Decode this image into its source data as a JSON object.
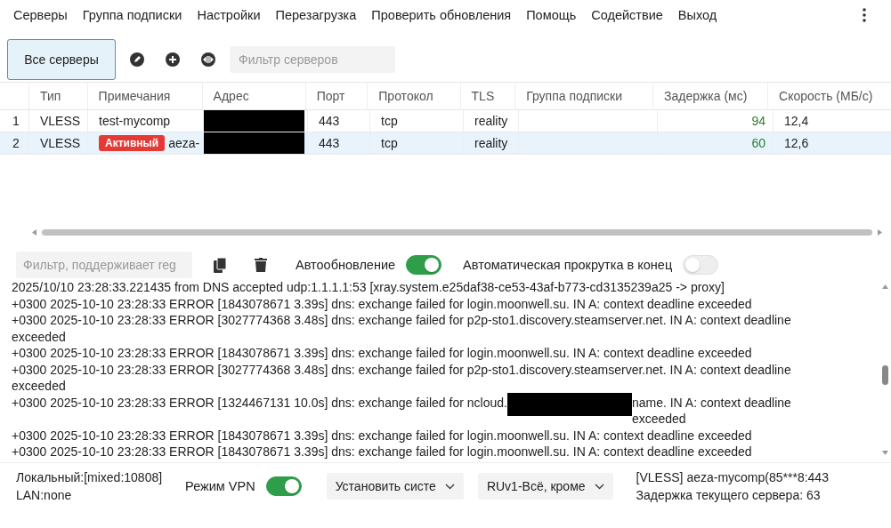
{
  "menu": [
    "Серверы",
    "Группа подписки",
    "Настройки",
    "Перезагрузка",
    "Проверить обновления",
    "Помощь",
    "Содействие",
    "Выход"
  ],
  "toolbar": {
    "tabs": [
      {
        "label": "Все серверы",
        "selected": true
      }
    ],
    "filter": {
      "placeholder": "Фильтр серверов"
    }
  },
  "table": {
    "columns": [
      "Тип",
      "Примечания",
      "Адрес",
      "Порт",
      "Протокол",
      "TLS",
      "Группа подписки",
      "Задержка (мс)",
      "Скорость (МБ/с)"
    ],
    "rows": [
      {
        "index": "1",
        "type": "VLESS",
        "badge": "",
        "note": "test-mycomp",
        "port": "443",
        "protocol": "tcp",
        "tls": "reality",
        "group": "",
        "delay": "94",
        "speed": "12,4",
        "selected": false
      },
      {
        "index": "2",
        "type": "VLESS",
        "badge": "Активный",
        "note": "aeza-",
        "port": "443",
        "protocol": "tcp",
        "tls": "reality",
        "group": "",
        "delay": "60",
        "speed": "12,6",
        "selected": true
      }
    ]
  },
  "log_toolbar": {
    "filter": {
      "placeholder": "Фильтр, поддерживает reg"
    },
    "auto_update": {
      "label": "Автообновление",
      "on": true
    },
    "auto_scroll": {
      "label": "Автоматическая прокрутка в конец",
      "on": false
    }
  },
  "log": [
    {
      "text": "2025/10/10 23:28:33.221435 from DNS accepted udp:1.1.1.1:53 [xray.system.e25daf38-ce53-43af-b773-cd3135239a25 -> proxy]"
    },
    {
      "text": "+0300 2025-10-10 23:28:33 ERROR [1843078671 3.39s] dns: exchange failed for login.moonwell.su. IN A: context deadline exceeded"
    },
    {
      "text": "+0300 2025-10-10 23:28:33 ERROR [3027774368 3.48s] dns: exchange failed for p2p-sto1.discovery.steamserver.net. IN A: context deadline exceeded"
    },
    {
      "text": "+0300 2025-10-10 23:28:33 ERROR [1843078671 3.39s] dns: exchange failed for login.moonwell.su. IN A: context deadline exceeded"
    },
    {
      "text": "+0300 2025-10-10 23:28:33 ERROR [3027774368 3.48s] dns: exchange failed for p2p-sto1.discovery.steamserver.net. IN A: context deadline exceeded"
    },
    {
      "text": "+0300 2025-10-10 23:28:33 ERROR [1324467131 10.0s] dns: exchange failed for ncloud.",
      "after": "name. IN A: context deadline exceeded"
    },
    {
      "text": "+0300 2025-10-10 23:28:33 ERROR [1843078671 3.39s] dns: exchange failed for login.moonwell.su. IN A: context deadline exceeded"
    },
    {
      "text": "+0300 2025-10-10 23:28:33 ERROR [1843078671 3.39s] dns: exchange failed for login.moonwell.su. IN A: context deadline exceeded"
    }
  ],
  "status_bar": {
    "local": "Локальный:[mixed:10808]",
    "lan": "LAN:none",
    "vpn": {
      "label": "Режим VPN",
      "on": true
    },
    "proxy_dropdown": "Установить систе",
    "routing_dropdown": "RUv1-Всё, кроме",
    "server": "[VLESS] aeza-mycomp(85***8:443",
    "server_delay": "Задержка текущего сервера: 63"
  }
}
